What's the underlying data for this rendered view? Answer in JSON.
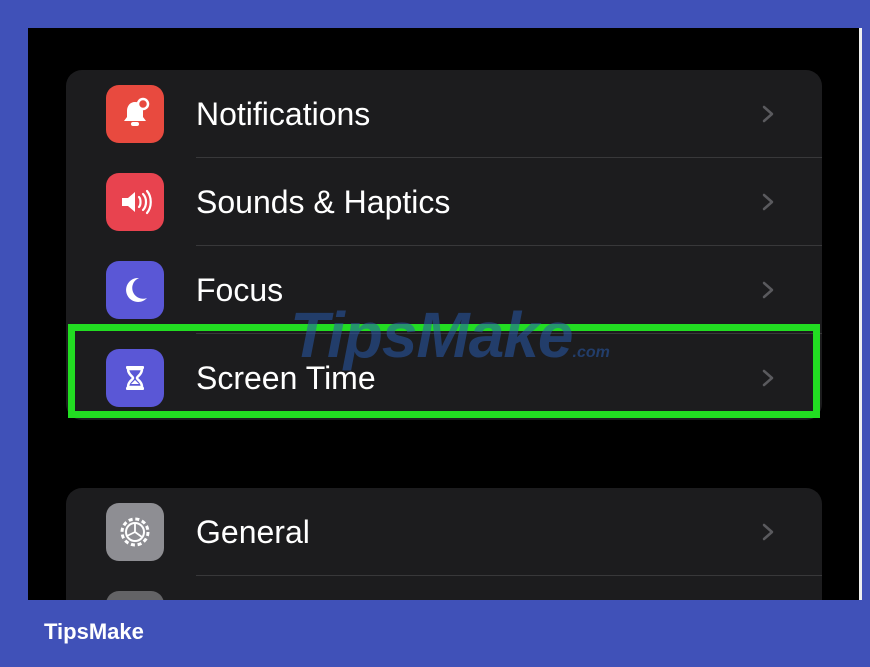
{
  "settings_group_1": {
    "items": [
      {
        "label": "Notifications",
        "icon": "notification-bell-icon",
        "color": "#e84a3f"
      },
      {
        "label": "Sounds & Haptics",
        "icon": "speaker-icon",
        "color": "#e8434f"
      },
      {
        "label": "Focus",
        "icon": "moon-icon",
        "color": "#5a57d6"
      },
      {
        "label": "Screen Time",
        "icon": "hourglass-icon",
        "color": "#5a57d6"
      }
    ]
  },
  "settings_group_2": {
    "items": [
      {
        "label": "General",
        "icon": "gear-icon",
        "color": "#8e8e93"
      }
    ]
  },
  "highlight": {
    "target": "Screen Time",
    "color": "#22dd22"
  },
  "watermark": {
    "text": "TipsMake",
    "suffix": ".com"
  },
  "footer": {
    "brand": "TipsMake",
    "background": "#4051b8"
  }
}
